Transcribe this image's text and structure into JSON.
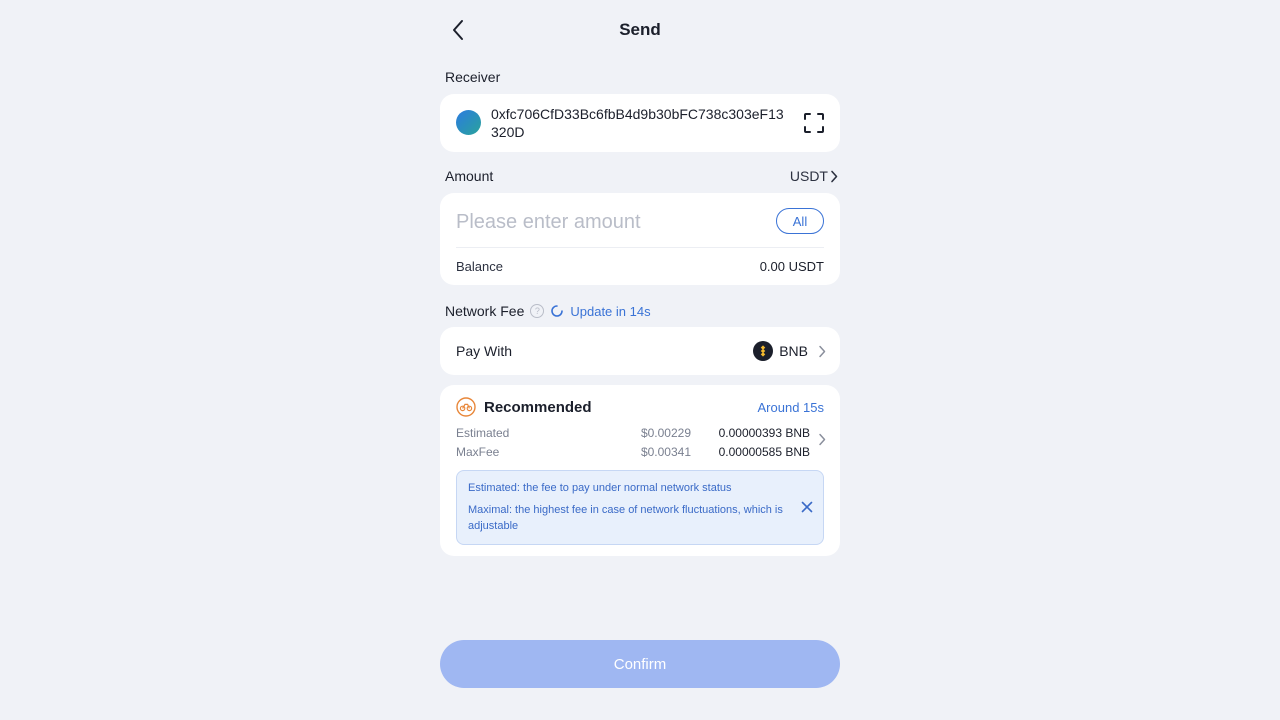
{
  "header": {
    "title": "Send",
    "back_icon": "chevron-left-icon"
  },
  "receiver": {
    "label": "Receiver",
    "address": "0xfc706CfD33Bc6fbB4d9b30bFC738c303eF13320D",
    "scan_icon": "scan-icon"
  },
  "amount": {
    "label": "Amount",
    "currency": "USDT",
    "placeholder": "Please enter amount",
    "value": "",
    "all_label": "All",
    "balance_label": "Balance",
    "balance_value": "0.00 USDT"
  },
  "network_fee": {
    "label": "Network Fee",
    "help_symbol": "?",
    "update_text": "Update in 14s",
    "pay_with_label": "Pay With",
    "pay_with_token": "BNB"
  },
  "recommended": {
    "title": "Recommended",
    "time": "Around 15s",
    "estimated_label": "Estimated",
    "estimated_usd": "$0.00229",
    "estimated_bnb": "0.00000393 BNB",
    "maxfee_label": "MaxFee",
    "maxfee_usd": "$0.00341",
    "maxfee_bnb": "0.00000585 BNB",
    "info_line1": "Estimated: the fee to pay under normal network status",
    "info_line2": "Maximal: the highest fee in case of network fluctuations, which is adjustable"
  },
  "confirm_label": "Confirm",
  "colors": {
    "accent": "#3a73d6",
    "confirm_disabled": "#9fb7f2",
    "background": "#f0f2f7",
    "info_bg": "#e8f0fc"
  }
}
